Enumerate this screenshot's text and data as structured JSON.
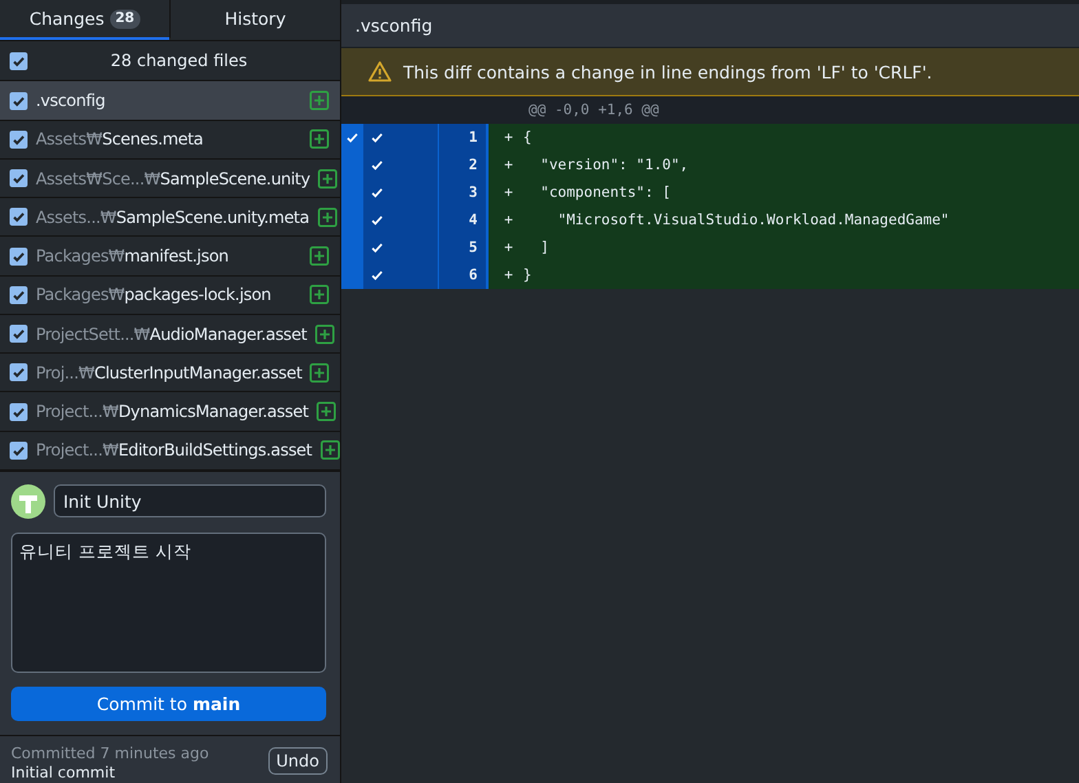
{
  "tabs": [
    {
      "label": "Changes",
      "count": "28",
      "selected": true
    },
    {
      "label": "History",
      "selected": false
    }
  ],
  "summary": {
    "label": "28 changed files",
    "checked": true
  },
  "files": [
    {
      "name": ".vsconfig",
      "checked": true,
      "selected": true,
      "kind": "added"
    },
    {
      "dir": "Assets₩",
      "name": "Scenes.meta",
      "checked": true,
      "selected": false,
      "kind": "added"
    },
    {
      "dir": "Assets₩Sce...₩",
      "name": "SampleScene.unity",
      "checked": true,
      "selected": false,
      "kind": "added"
    },
    {
      "dir": "Assets...₩",
      "name": "SampleScene.unity.meta",
      "checked": true,
      "selected": false,
      "kind": "added"
    },
    {
      "dir": "Packages₩",
      "name": "manifest.json",
      "checked": true,
      "selected": false,
      "kind": "added"
    },
    {
      "dir": "Packages₩",
      "name": "packages-lock.json",
      "checked": true,
      "selected": false,
      "kind": "added"
    },
    {
      "dir": "ProjectSett...₩",
      "name": "AudioManager.asset",
      "checked": true,
      "selected": false,
      "kind": "added"
    },
    {
      "dir": "Proj...₩",
      "name": "ClusterInputManager.asset",
      "checked": true,
      "selected": false,
      "kind": "added"
    },
    {
      "dir": "Project...₩",
      "name": "DynamicsManager.asset",
      "checked": true,
      "selected": false,
      "kind": "added"
    },
    {
      "dir": "Project...₩",
      "name": "EditorBuildSettings.asset",
      "checked": true,
      "selected": false,
      "kind": "added"
    }
  ],
  "commit": {
    "summary": "Init Unity",
    "description": "유니티 프로젝트 시작",
    "button": "Commit to",
    "branch": "main"
  },
  "last_commit": {
    "time": "Committed 7 minutes ago",
    "message": "Initial commit",
    "undo": "Undo"
  },
  "diff": {
    "filename": ".vsconfig",
    "warning": "This diff contains a change in line endings from 'LF' to 'CRLF'.",
    "hunk_header": "@@ -0,0 +1,6 @@",
    "hunk_selected": true,
    "lines": [
      {
        "number": "1",
        "marker": "+",
        "code": "{",
        "included": true
      },
      {
        "number": "2",
        "marker": "+",
        "code": "  \"version\": \"1.0\",",
        "included": true
      },
      {
        "number": "3",
        "marker": "+",
        "code": "  \"components\": [",
        "included": true
      },
      {
        "number": "4",
        "marker": "+",
        "code": "    \"Microsoft.VisualStudio.Workload.ManagedGame\"",
        "included": true
      },
      {
        "number": "5",
        "marker": "+",
        "code": "  ]",
        "included": true
      },
      {
        "number": "6",
        "marker": "+",
        "code": "}",
        "included": true
      }
    ]
  }
}
